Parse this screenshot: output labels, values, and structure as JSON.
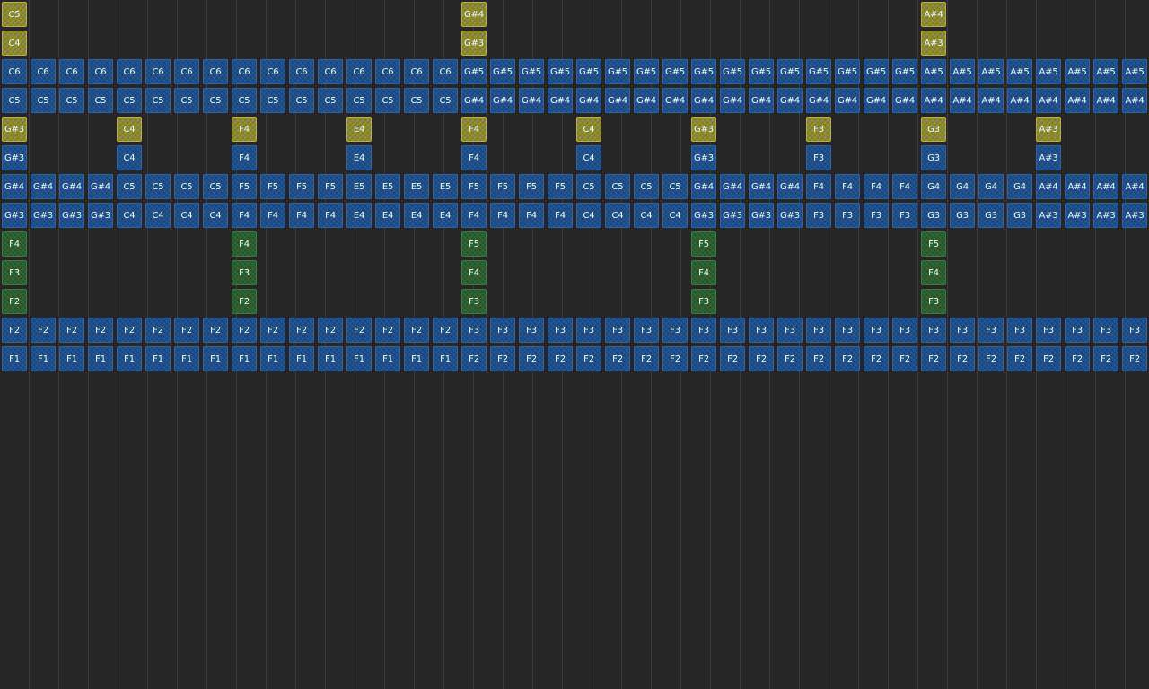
{
  "colors": {
    "background": "#262627",
    "grid_line": "#3b3b3c",
    "blue_block": "#1d4f8c",
    "yellow_block": "#8c8a2e",
    "green_block": "#2a5e2e",
    "block_text": "#f4f6f8"
  },
  "rows": [
    {
      "color": "yellow",
      "cells": [
        "C5",
        null,
        null,
        null,
        null,
        null,
        null,
        null,
        null,
        null,
        null,
        null,
        null,
        null,
        null,
        null,
        "G#4",
        null,
        null,
        null,
        null,
        null,
        null,
        null,
        null,
        null,
        null,
        null,
        null,
        null,
        null,
        null,
        "A#4",
        null,
        null,
        null,
        null,
        null,
        null,
        null
      ]
    },
    {
      "color": "yellow",
      "cells": [
        "C4",
        null,
        null,
        null,
        null,
        null,
        null,
        null,
        null,
        null,
        null,
        null,
        null,
        null,
        null,
        null,
        "G#3",
        null,
        null,
        null,
        null,
        null,
        null,
        null,
        null,
        null,
        null,
        null,
        null,
        null,
        null,
        null,
        "A#3",
        null,
        null,
        null,
        null,
        null,
        null,
        null
      ]
    },
    {
      "color": "blue",
      "cells": [
        "C6",
        "C6",
        "C6",
        "C6",
        "C6",
        "C6",
        "C6",
        "C6",
        "C6",
        "C6",
        "C6",
        "C6",
        "C6",
        "C6",
        "C6",
        "C6",
        "G#5",
        "G#5",
        "G#5",
        "G#5",
        "G#5",
        "G#5",
        "G#5",
        "G#5",
        "G#5",
        "G#5",
        "G#5",
        "G#5",
        "G#5",
        "G#5",
        "G#5",
        "G#5",
        "A#5",
        "A#5",
        "A#5",
        "A#5",
        "A#5",
        "A#5",
        "A#5",
        "A#5"
      ]
    },
    {
      "color": "blue",
      "cells": [
        "C5",
        "C5",
        "C5",
        "C5",
        "C5",
        "C5",
        "C5",
        "C5",
        "C5",
        "C5",
        "C5",
        "C5",
        "C5",
        "C5",
        "C5",
        "C5",
        "G#4",
        "G#4",
        "G#4",
        "G#4",
        "G#4",
        "G#4",
        "G#4",
        "G#4",
        "G#4",
        "G#4",
        "G#4",
        "G#4",
        "G#4",
        "G#4",
        "G#4",
        "G#4",
        "A#4",
        "A#4",
        "A#4",
        "A#4",
        "A#4",
        "A#4",
        "A#4",
        "A#4"
      ]
    },
    {
      "color": "yellow",
      "cells": [
        "G#3",
        null,
        null,
        null,
        "C4",
        null,
        null,
        null,
        "F4",
        null,
        null,
        null,
        "E4",
        null,
        null,
        null,
        "F4",
        null,
        null,
        null,
        "C4",
        null,
        null,
        null,
        "G#3",
        null,
        null,
        null,
        "F3",
        null,
        null,
        null,
        "G3",
        null,
        null,
        null,
        "A#3",
        null,
        null,
        null
      ]
    },
    {
      "color": "blue",
      "cells": [
        "G#3",
        null,
        null,
        null,
        "C4",
        null,
        null,
        null,
        "F4",
        null,
        null,
        null,
        "E4",
        null,
        null,
        null,
        "F4",
        null,
        null,
        null,
        "C4",
        null,
        null,
        null,
        "G#3",
        null,
        null,
        null,
        "F3",
        null,
        null,
        null,
        "G3",
        null,
        null,
        null,
        "A#3",
        null,
        null,
        null
      ]
    },
    {
      "color": "blue",
      "cells": [
        "G#4",
        "G#4",
        "G#4",
        "G#4",
        "C5",
        "C5",
        "C5",
        "C5",
        "F5",
        "F5",
        "F5",
        "F5",
        "E5",
        "E5",
        "E5",
        "E5",
        "F5",
        "F5",
        "F5",
        "F5",
        "C5",
        "C5",
        "C5",
        "C5",
        "G#4",
        "G#4",
        "G#4",
        "G#4",
        "F4",
        "F4",
        "F4",
        "F4",
        "G4",
        "G4",
        "G4",
        "G4",
        "A#4",
        "A#4",
        "A#4",
        "A#4"
      ]
    },
    {
      "color": "blue",
      "cells": [
        "G#3",
        "G#3",
        "G#3",
        "G#3",
        "C4",
        "C4",
        "C4",
        "C4",
        "F4",
        "F4",
        "F4",
        "F4",
        "E4",
        "E4",
        "E4",
        "E4",
        "F4",
        "F4",
        "F4",
        "F4",
        "C4",
        "C4",
        "C4",
        "C4",
        "G#3",
        "G#3",
        "G#3",
        "G#3",
        "F3",
        "F3",
        "F3",
        "F3",
        "G3",
        "G3",
        "G3",
        "G3",
        "A#3",
        "A#3",
        "A#3",
        "A#3"
      ]
    },
    {
      "color": "green",
      "cells": [
        "F4",
        null,
        null,
        null,
        null,
        null,
        null,
        null,
        "F4",
        null,
        null,
        null,
        null,
        null,
        null,
        null,
        "F5",
        null,
        null,
        null,
        null,
        null,
        null,
        null,
        "F5",
        null,
        null,
        null,
        null,
        null,
        null,
        null,
        "F5",
        null,
        null,
        null,
        null,
        null,
        null,
        null
      ]
    },
    {
      "color": "green",
      "cells": [
        "F3",
        null,
        null,
        null,
        null,
        null,
        null,
        null,
        "F3",
        null,
        null,
        null,
        null,
        null,
        null,
        null,
        "F4",
        null,
        null,
        null,
        null,
        null,
        null,
        null,
        "F4",
        null,
        null,
        null,
        null,
        null,
        null,
        null,
        "F4",
        null,
        null,
        null,
        null,
        null,
        null,
        null
      ]
    },
    {
      "color": "green",
      "cells": [
        "F2",
        null,
        null,
        null,
        null,
        null,
        null,
        null,
        "F2",
        null,
        null,
        null,
        null,
        null,
        null,
        null,
        "F3",
        null,
        null,
        null,
        null,
        null,
        null,
        null,
        "F3",
        null,
        null,
        null,
        null,
        null,
        null,
        null,
        "F3",
        null,
        null,
        null,
        null,
        null,
        null,
        null
      ]
    },
    {
      "color": "blue",
      "cells": [
        "F2",
        "F2",
        "F2",
        "F2",
        "F2",
        "F2",
        "F2",
        "F2",
        "F2",
        "F2",
        "F2",
        "F2",
        "F2",
        "F2",
        "F2",
        "F2",
        "F3",
        "F3",
        "F3",
        "F3",
        "F3",
        "F3",
        "F3",
        "F3",
        "F3",
        "F3",
        "F3",
        "F3",
        "F3",
        "F3",
        "F3",
        "F3",
        "F3",
        "F3",
        "F3",
        "F3",
        "F3",
        "F3",
        "F3",
        "F3"
      ]
    },
    {
      "color": "blue",
      "cells": [
        "F1",
        "F1",
        "F1",
        "F1",
        "F1",
        "F1",
        "F1",
        "F1",
        "F1",
        "F1",
        "F1",
        "F1",
        "F1",
        "F1",
        "F1",
        "F1",
        "F2",
        "F2",
        "F2",
        "F2",
        "F2",
        "F2",
        "F2",
        "F2",
        "F2",
        "F2",
        "F2",
        "F2",
        "F2",
        "F2",
        "F2",
        "F2",
        "F2",
        "F2",
        "F2",
        "F2",
        "F2",
        "F2",
        "F2",
        "F2"
      ]
    }
  ]
}
